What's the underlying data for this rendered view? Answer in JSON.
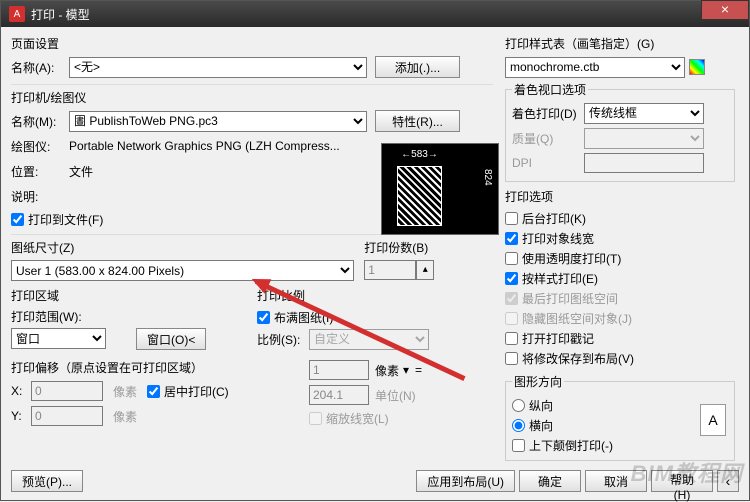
{
  "titlebar": {
    "title": "打印 - 模型",
    "close": "×",
    "logo": "A"
  },
  "page_setup": {
    "title": "页面设置",
    "name_label": "名称(A):",
    "name_value": "<无>",
    "add_btn": "添加(.)..."
  },
  "printer": {
    "title": "打印机/绘图仪",
    "name_label": "名称(M):",
    "name_value": "圕 PublishToWeb PNG.pc3",
    "props_btn": "特性(R)...",
    "plotter_label": "绘图仪:",
    "plotter_value": "Portable Network Graphics PNG (LZH Compress...",
    "where_label": "位置:",
    "where_value": "文件",
    "desc_label": "说明:",
    "desc_value": "",
    "plot_to_file": "打印到文件(F)",
    "preview_w": "583",
    "preview_h": "824"
  },
  "paper": {
    "title": "图纸尺寸(Z)",
    "value": "User 1 (583.00 x 824.00 Pixels)"
  },
  "copies": {
    "title": "打印份数(B)",
    "value": "1"
  },
  "area": {
    "title": "打印区域",
    "what_label": "打印范围(W):",
    "what_value": "窗口",
    "window_btn": "窗口(O)<"
  },
  "scale": {
    "title": "打印比例",
    "fit": "布满图纸(I)",
    "scale_label": "比例(S):",
    "scale_value": "自定义",
    "num": "1",
    "unit1": "像素",
    "denom": "204.1",
    "unit2": "单位(N)",
    "scale_lw": "缩放线宽(L)"
  },
  "offset": {
    "title": "打印偏移（原点设置在可打印区域）",
    "x_label": "X:",
    "y_label": "Y:",
    "x_val": "0",
    "y_val": "0",
    "unit": "像素",
    "center": "居中打印(C)"
  },
  "style_table": {
    "title": "打印样式表（画笔指定）(G)",
    "value": "monochrome.ctb"
  },
  "viewport": {
    "title": "着色视口选项",
    "shade_label": "着色打印(D)",
    "shade_value": "传统线框",
    "quality_label": "质量(Q)",
    "dpi_label": "DPI"
  },
  "options": {
    "title": "打印选项",
    "o1": "后台打印(K)",
    "o2": "打印对象线宽",
    "o3": "使用透明度打印(T)",
    "o4": "按样式打印(E)",
    "o5": "最后打印图纸空间",
    "o6": "隐藏图纸空间对象(J)",
    "o7": "打开打印戳记",
    "o8": "将修改保存到布局(V)"
  },
  "orientation": {
    "title": "图形方向",
    "portrait": "纵向",
    "landscape": "横向",
    "upside": "上下颠倒打印(-)",
    "icon": "A"
  },
  "footer": {
    "preview": "预览(P)...",
    "apply": "应用到布局(U)",
    "ok": "确定",
    "cancel": "取消",
    "help": "帮助(H)",
    "expand": "‹"
  },
  "watermark": "BIM教程网"
}
